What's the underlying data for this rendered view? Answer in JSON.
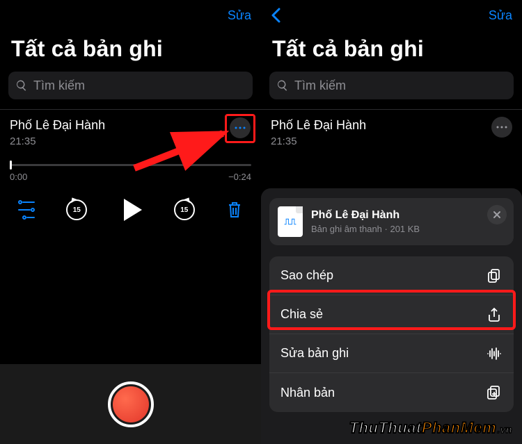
{
  "nav": {
    "edit_label": "Sửa"
  },
  "page": {
    "title": "Tất cả bản ghi"
  },
  "search": {
    "placeholder": "Tìm kiếm"
  },
  "recording": {
    "name": "Phố Lê Đại Hành",
    "time": "21:35",
    "elapsed": "0:00",
    "remaining": "−0:24",
    "skip_seconds": "15"
  },
  "sheet": {
    "file_name": "Phố Lê Đại Hành",
    "file_subtitle": "Bản ghi âm thanh · 201 KB",
    "items": {
      "copy": "Sao chép",
      "share": "Chia sẻ",
      "edit": "Sửa bản ghi",
      "duplicate": "Nhân bản"
    }
  },
  "watermark": {
    "part1": "ThuThuat",
    "part2": "PhanMem",
    "suffix": ".vn"
  },
  "colors": {
    "accent": "#0a84ff",
    "highlight": "#ff1a1a"
  }
}
